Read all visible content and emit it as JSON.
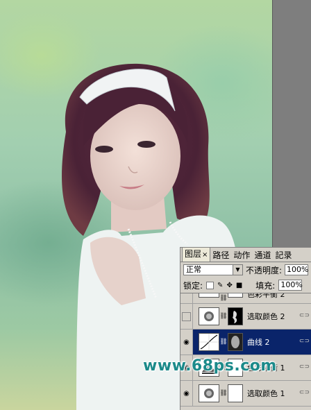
{
  "layers_panel": {
    "tabs": [
      {
        "label": "图层",
        "active": true
      },
      {
        "label": "路径"
      },
      {
        "label": "动作"
      },
      {
        "label": "通道"
      },
      {
        "label": "記录"
      }
    ],
    "tab_close": "×",
    "blend_mode": "正常",
    "opacity_label": "不透明度:",
    "opacity_value": "100%",
    "lock_label": "锁定:",
    "fill_label": "填充:",
    "fill_value": "100%",
    "layers": [
      {
        "name": "色彩平衡 2",
        "visible": false,
        "partial": true
      },
      {
        "name": "选取颜色 2",
        "visible": false
      },
      {
        "name": "曲线 2",
        "visible": true,
        "selected": true
      },
      {
        "name": "色彩平衡 1",
        "visible": true
      },
      {
        "name": "选取颜色 1",
        "visible": true
      }
    ]
  },
  "watermark": "www.68ps.com"
}
